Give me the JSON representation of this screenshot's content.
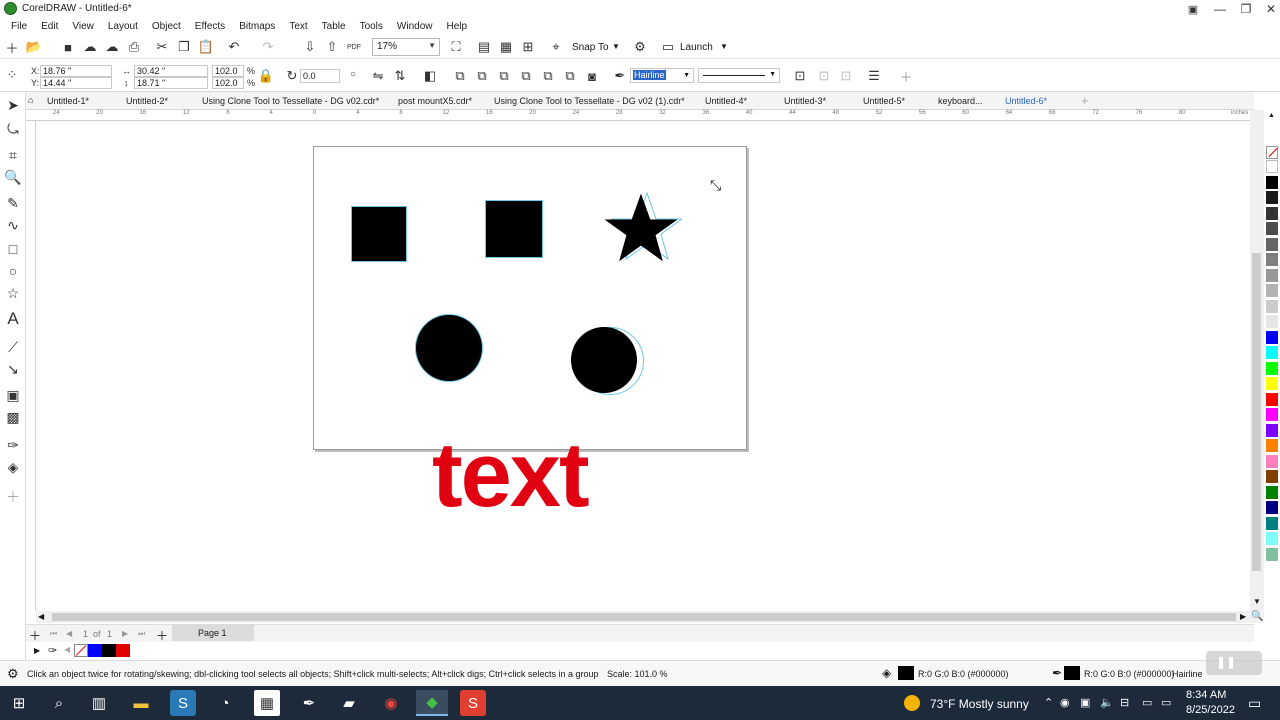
{
  "window": {
    "title": "CorelDRAW - Untitled-6*"
  },
  "menu": [
    "File",
    "Edit",
    "View",
    "Layout",
    "Object",
    "Effects",
    "Bitmaps",
    "Text",
    "Table",
    "Tools",
    "Window",
    "Help"
  ],
  "toolbar": {
    "zoom": "17%",
    "snap_to": "Snap To",
    "launch": "Launch",
    "pdf": "PDF"
  },
  "propbar": {
    "x_label": "X:",
    "x": "18.76 \"",
    "y_label": "Y:",
    "y": "14.44 \"",
    "w": "30.42 \"",
    "h": "18.71 \"",
    "scale_w": "102.0",
    "scale_h": "102.0",
    "percent": "%",
    "rotation": "0.0",
    "outline_width": "Hairline"
  },
  "tabs": [
    "Untitled-1*",
    "Untitled-2*",
    "Using Clone Tool to Tessellate - DG v02.cdr*",
    "post mountX5.cdr*",
    "Using Clone Tool to Tessellate - DG v02 (1).cdr*",
    "Untitled-4*",
    "Untitled-3*",
    "Untitled-5*",
    "keyboard...",
    "Untitled-6*"
  ],
  "ruler": {
    "ticks": [
      "24",
      "20",
      "16",
      "12",
      "8",
      "4",
      "0",
      "4",
      "8",
      "12",
      "16",
      "20",
      "24",
      "28",
      "32",
      "36",
      "40",
      "44",
      "48",
      "52",
      "56",
      "60",
      "64",
      "68",
      "72",
      "76",
      "80"
    ],
    "unit": "inches"
  },
  "canvas": {
    "text": "text"
  },
  "page_nav": {
    "current": "1",
    "of_label": "of",
    "total": "1",
    "page_label": "Page 1"
  },
  "status": {
    "hint": "Click an object twice for rotating/skewing; dbl-clicking tool selects all objects; Shift+click multi-selects; Alt+click digs; Ctrl+click selects in a group",
    "scale": "Scale: 101.0 %",
    "fill": "R:0 G:0 B:0 (#000000)",
    "outline": "R:0 G:0 B:0 (#000000)",
    "outline_width": "Hairline"
  },
  "taskbar": {
    "weather": "73°F  Mostly sunny",
    "time": "8:34 AM",
    "date": "8/25/2022"
  },
  "colors": {
    "accent": "#2a66c9",
    "text_red": "#e00012",
    "palette": [
      "#ffffff",
      "#000000",
      "#1a1a1a",
      "#333333",
      "#4d4d4d",
      "#666666",
      "#808080",
      "#999999",
      "#b3b3b3",
      "#cccccc",
      "#e6e6e6",
      "#0000ff",
      "#00ffff",
      "#00ff00",
      "#ffff00",
      "#ff0000",
      "#ff00ff",
      "#8000ff",
      "#ff8000",
      "#ff80c0",
      "#804000",
      "#008000",
      "#000080",
      "#008080",
      "#80ffff",
      "#80c0a0"
    ]
  }
}
